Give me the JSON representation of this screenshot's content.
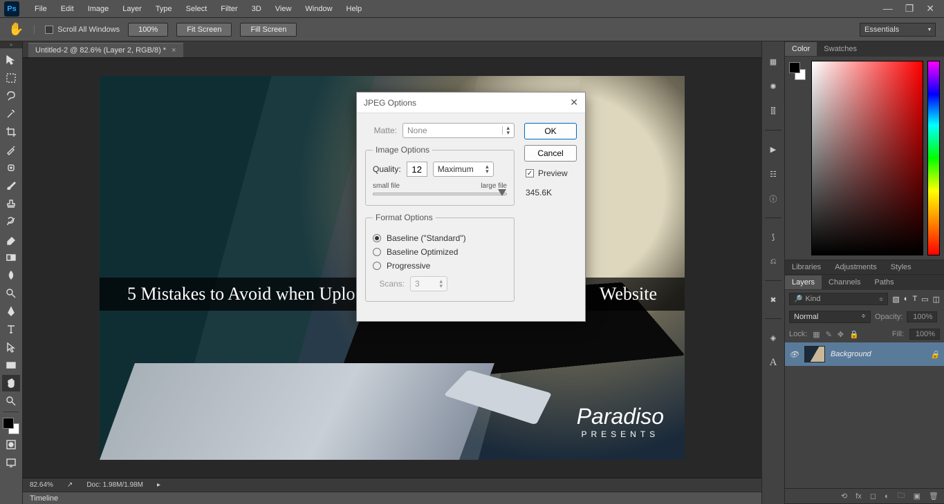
{
  "menu": {
    "items": [
      "File",
      "Edit",
      "Image",
      "Layer",
      "Type",
      "Select",
      "Filter",
      "3D",
      "View",
      "Window",
      "Help"
    ]
  },
  "options": {
    "scroll_all": "Scroll All Windows",
    "btn_100": "100%",
    "btn_fit": "Fit Screen",
    "btn_fill": "Fill Screen",
    "workspace": "Essentials"
  },
  "doc": {
    "tab_title": "Untitled-2 @ 82.6% (Layer 2, RGB/8) *",
    "overlay_left": "5 Mistakes to Avoid when Uplo",
    "overlay_right": "Website",
    "watermark_script": "Paradiso",
    "watermark_sub": "PRESENTS",
    "zoom": "82.64%",
    "docinfo": "Doc: 1.98M/1.98M",
    "timeline": "Timeline"
  },
  "panel_tabs": {
    "color": "Color",
    "swatches": "Swatches",
    "libraries": "Libraries",
    "adjustments": "Adjustments",
    "styles": "Styles",
    "layers": "Layers",
    "channels": "Channels",
    "paths": "Paths"
  },
  "layers": {
    "kind_search": "Kind",
    "blend": "Normal",
    "opacity_lbl": "Opacity:",
    "opacity": "100%",
    "lock_lbl": "Lock:",
    "fill_lbl": "Fill:",
    "fill": "100%",
    "bg_layer": "Background"
  },
  "dialog": {
    "title": "JPEG Options",
    "matte_lbl": "Matte:",
    "matte_val": "None",
    "image_options": "Image Options",
    "quality_lbl": "Quality:",
    "quality_val": "12",
    "quality_preset": "Maximum",
    "small": "small file",
    "large": "large file",
    "format_options": "Format Options",
    "opt_standard": "Baseline (\"Standard\")",
    "opt_optimized": "Baseline Optimized",
    "opt_progressive": "Progressive",
    "scans_lbl": "Scans:",
    "scans_val": "3",
    "ok": "OK",
    "cancel": "Cancel",
    "preview": "Preview",
    "filesize": "345.6K"
  }
}
